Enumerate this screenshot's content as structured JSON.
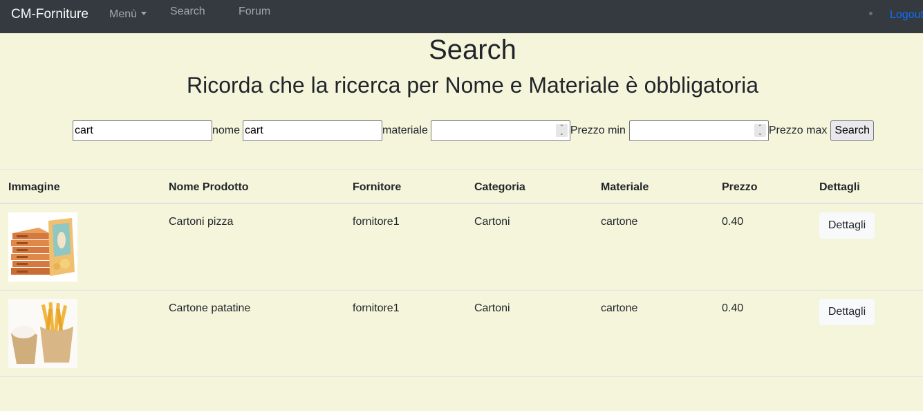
{
  "navbar": {
    "brand": "CM-Forniture",
    "menu_label": "Menù",
    "links": [
      "Search",
      "Forum"
    ],
    "logout_label": "Logout"
  },
  "page": {
    "title": "Search",
    "subtitle": "Ricorda che la ricerca per Nome e Materiale è obbligatoria"
  },
  "form": {
    "nome_value": "cart",
    "nome_label": "nome",
    "materiale_value": "cart",
    "materiale_label": "materiale",
    "prezzo_min_value": "",
    "prezzo_min_label": "Prezzo min",
    "prezzo_max_value": "",
    "prezzo_max_label": "Prezzo max",
    "search_button": "Search"
  },
  "table": {
    "headers": [
      "Immagine",
      "Nome Prodotto",
      "Fornitore",
      "Categoria",
      "Materiale",
      "Prezzo",
      "Dettagli"
    ],
    "rows": [
      {
        "image": "pizza-boxes-image",
        "nome": "Cartoni pizza",
        "fornitore": "fornitore1",
        "categoria": "Cartoni",
        "materiale": "cartone",
        "prezzo": "0.40",
        "dettagli": "Dettagli"
      },
      {
        "image": "fries-box-image",
        "nome": "Cartone patatine",
        "fornitore": "fornitore1",
        "categoria": "Cartoni",
        "materiale": "cartone",
        "prezzo": "0.40",
        "dettagli": "Dettagli"
      }
    ]
  },
  "colors": {
    "background": "#f5f5dc",
    "navbar": "#343a40",
    "link": "#0d6efd"
  }
}
